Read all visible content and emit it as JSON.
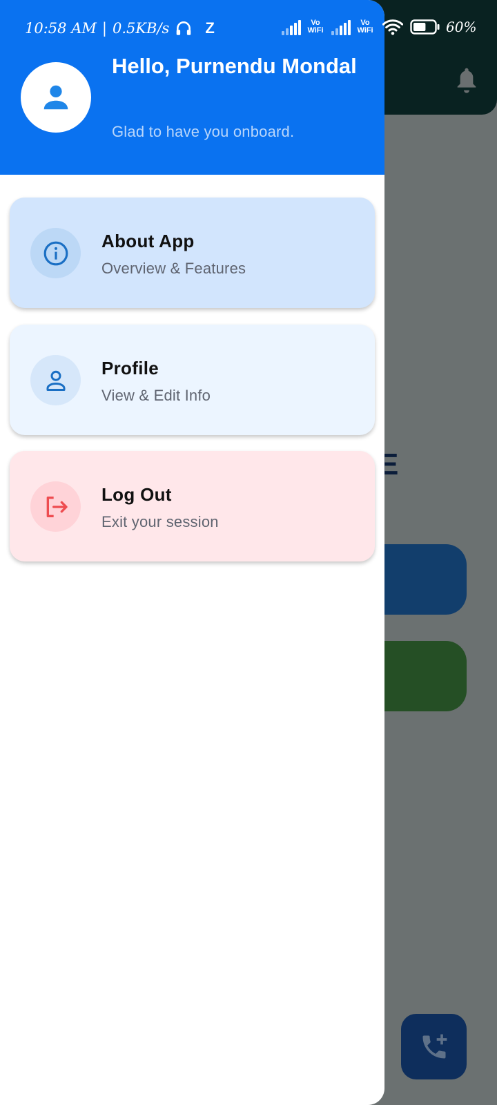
{
  "status_bar": {
    "time": "10:58 AM",
    "separator": "|",
    "speed": "0.5KB/s",
    "z_label": "Z",
    "vowifi_1": "Vo WiFi",
    "vowifi_2": "Vo WiFi",
    "battery": "60%",
    "battery_level": 0.6
  },
  "drawer": {
    "greeting": "Hello, Purnendu Mondal",
    "subtitle": "Glad to have you onboard.",
    "items": [
      {
        "title": "About App",
        "subtitle": "Overview & Features",
        "icon": "info-icon"
      },
      {
        "title": "Profile",
        "subtitle": "View & Edit Info",
        "icon": "person-icon"
      },
      {
        "title": "Log Out",
        "subtitle": "Exit your session",
        "icon": "logout-icon"
      }
    ]
  },
  "background": {
    "partial_letter": "E",
    "bell_icon": "bell-icon",
    "fab_icon": "add-call-icon"
  },
  "colors": {
    "header_blue": "#0a72f0",
    "about_card": "#d2e5fd",
    "profile_card": "#ecf5ff",
    "logout_card": "#ffe7ea",
    "logout_accent": "#ee4c50",
    "icon_blue": "#1a6fc4"
  }
}
